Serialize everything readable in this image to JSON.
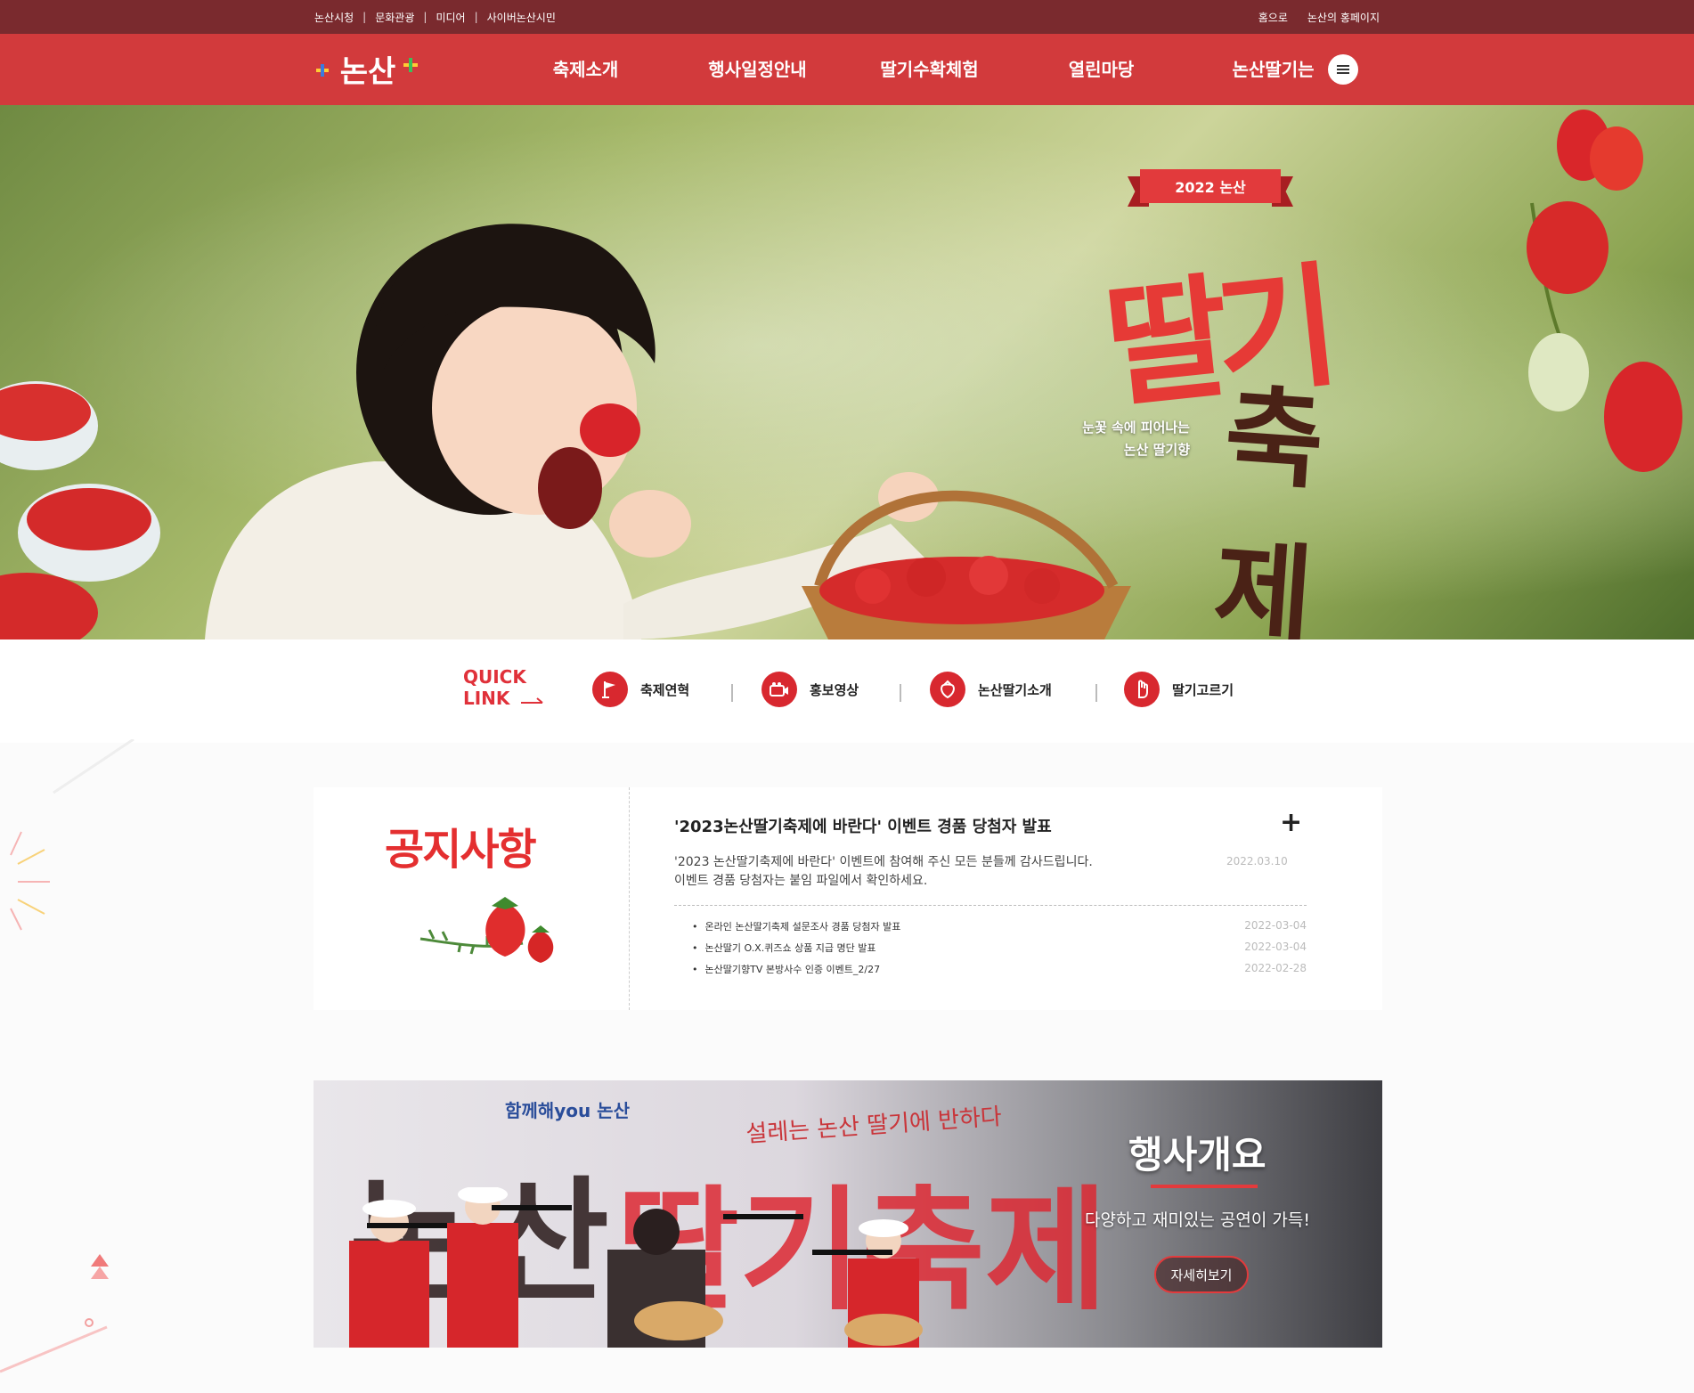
{
  "topbar": {
    "links": [
      "논산시청",
      "문화관광",
      "미디어",
      "사이버논산시민"
    ],
    "right_links": [
      "홈으로",
      "논산의 홍페이지"
    ]
  },
  "nav": {
    "logo_text": "논산",
    "items": [
      "축제소개",
      "행사일정안내",
      "딸기수확체험",
      "열린마당",
      "논산딸기는"
    ]
  },
  "hero": {
    "badge": "2022 논산",
    "title_line1": "딸기",
    "title_line2": "축제",
    "subtitle_line1": "눈꽃 속에 피어나는",
    "subtitle_line2": "논산 딸기향"
  },
  "quick_link": {
    "label_line1": "QUICK",
    "label_line2": "LINK",
    "items": [
      {
        "label": "축제연혁",
        "icon": "flag-icon"
      },
      {
        "label": "홍보영상",
        "icon": "video-icon"
      },
      {
        "label": "논산딸기소개",
        "icon": "strawberry-icon"
      },
      {
        "label": "딸기고르기",
        "icon": "hand-icon"
      }
    ]
  },
  "notice": {
    "title": "공지사항",
    "featured": {
      "title": "'2023논산딸기축제에 바란다' 이벤트 경품 당첨자 발표",
      "desc_line1": "'2023 논산딸기축제에 바란다' 이벤트에 참여해 주신 모든 분들께 감사드립니다.",
      "desc_line2": "이벤트 경품 당첨자는 붙임 파일에서 확인하세요.",
      "date": "2022.03.10"
    },
    "list": [
      {
        "title": "온라인 논산딸기축제 설문조사 경품 당첨자 발표",
        "date": "2022-03-04"
      },
      {
        "title": "논산딸기 O.X.퀴즈쇼 상품 지급 명단 발표",
        "date": "2022-03-04"
      },
      {
        "title": "논산딸기향TV 본방사수 인증 이벤트_2/27",
        "date": "2022-02-28"
      }
    ]
  },
  "event": {
    "slogan": "함께해you 논산",
    "headline": "설레는 논산 딸기에 반하다",
    "title": "행사개요",
    "desc": "다양하고 재미있는 공연이 가득!",
    "button": "자세히보기"
  },
  "colors": {
    "brand_red": "#d23a3c",
    "dark_red": "#7a2a2e"
  }
}
